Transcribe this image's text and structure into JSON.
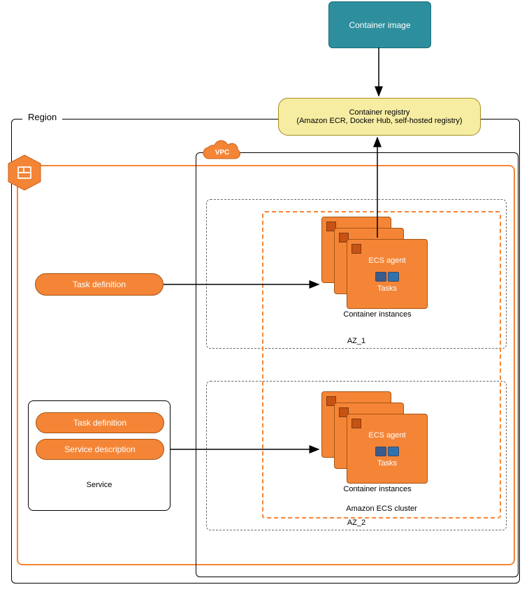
{
  "labels": {
    "region": "Region",
    "container_image": "Container image",
    "registry_title": "Container registry",
    "registry_subtitle": "(Amazon ECR, Docker Hub, self-hosted registry)",
    "vpc": "VPC",
    "task_definition": "Task definition",
    "service": "Service",
    "service_description": "Service description",
    "ecs_agent": "ECS agent",
    "tasks": "Tasks",
    "container_instances": "Container instances",
    "az1": "AZ_1",
    "az2": "AZ_2",
    "ecs_cluster": "Amazon ECS cluster"
  },
  "colors": {
    "aws_orange": "#f58536",
    "aws_teal": "#2d8f9e",
    "registry_bg": "#f6eda3"
  },
  "structure": {
    "availability_zones": [
      "AZ_1",
      "AZ_2"
    ],
    "arrows": [
      {
        "from": "container_image",
        "to": "container_registry"
      },
      {
        "from": "ecs_agent_az1",
        "to": "container_registry"
      },
      {
        "from": "task_definition_1",
        "to": "container_instances_az1"
      },
      {
        "from": "service_description",
        "to": "container_instances_az2"
      }
    ]
  }
}
